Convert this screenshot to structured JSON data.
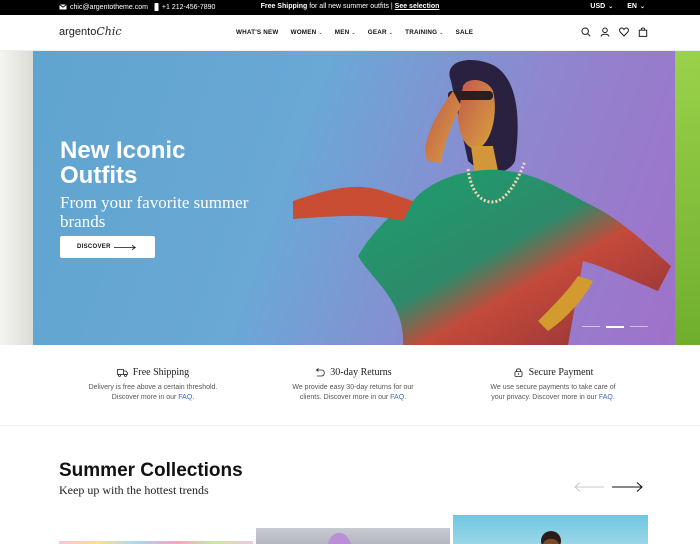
{
  "topbar": {
    "email": "chic@argentotheme.com",
    "phone": "+1 212-456-7890",
    "promo_bold": "Free Shipping",
    "promo_text": " for all new summer outfits | ",
    "promo_link": "See selection",
    "currency": "USD",
    "language": "EN"
  },
  "header": {
    "logo_main": "argento",
    "logo_script": "Chic",
    "nav": {
      "whats_new": "WHAT'S NEW",
      "women": "WOMEN",
      "men": "MEN",
      "gear": "GEAR",
      "training": "TRAINING",
      "sale": "SALE"
    },
    "icons": [
      "search-icon",
      "user-icon",
      "heart-icon",
      "bag-icon"
    ]
  },
  "hero": {
    "title": "New Iconic Outfits",
    "subtitle": "From your favorite summer brands",
    "button_label": "DISCOVER",
    "slides_count": 3,
    "active_slide": 2
  },
  "features": [
    {
      "title": "Free Shipping",
      "line1": "Delivery is free above a certain threshold.",
      "line2": "Discover more in our ",
      "link": "FAQ",
      "tail": "."
    },
    {
      "title": "30-day Returns",
      "line1": "We provide easy 30-day returns for our",
      "line2": "clients. Discover more in our ",
      "link": "FAQ",
      "tail": "."
    },
    {
      "title": "Secure Payment",
      "line1": "We use secure payments to take care of",
      "line2": "your privacy. Discover more in our ",
      "link": "FAQ",
      "tail": "."
    }
  ],
  "collections": {
    "title": "Summer Collections",
    "subtitle": "Keep up with the hottest trends"
  },
  "colors": {
    "topbar_bg": "#000000",
    "link": "#3a6fb8",
    "hero_blue": "#5fa4cf",
    "hero_purple": "#a071c9"
  }
}
